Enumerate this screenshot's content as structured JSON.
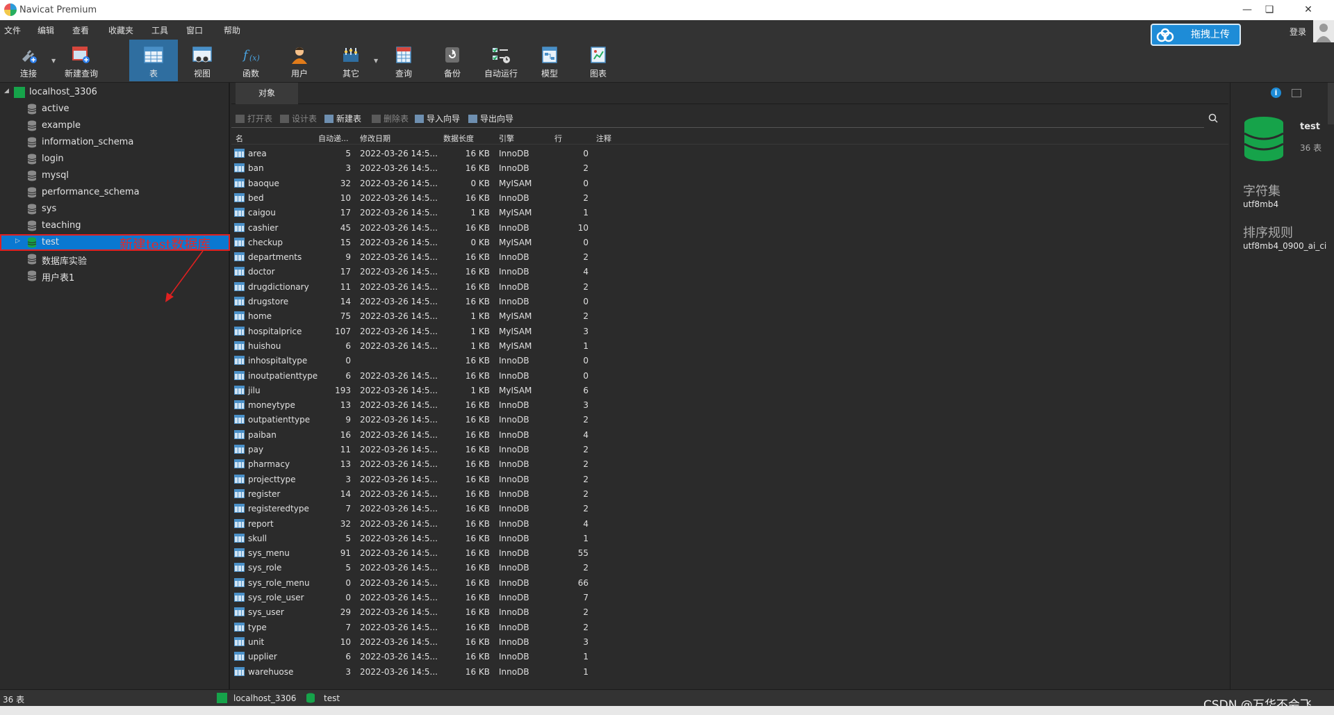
{
  "window": {
    "title": "Navicat Premium"
  },
  "menu": [
    "文件",
    "编辑",
    "查看",
    "收藏夹",
    "工具",
    "窗口",
    "帮助"
  ],
  "toolbar": [
    {
      "label": "连接",
      "icon": "plug-icon"
    },
    {
      "label": "新建查询",
      "icon": "new-query-icon"
    },
    {
      "label": "表",
      "icon": "table-icon",
      "active": true
    },
    {
      "label": "视图",
      "icon": "view-icon"
    },
    {
      "label": "函数",
      "icon": "function-icon"
    },
    {
      "label": "用户",
      "icon": "user-icon"
    },
    {
      "label": "其它",
      "icon": "others-icon"
    },
    {
      "label": "查询",
      "icon": "query-icon"
    },
    {
      "label": "备份",
      "icon": "backup-icon"
    },
    {
      "label": "自动运行",
      "icon": "autorun-icon"
    },
    {
      "label": "模型",
      "icon": "model-icon"
    },
    {
      "label": "图表",
      "icon": "chart-icon"
    }
  ],
  "upload_button": "拖拽上传",
  "login": "登录",
  "tree": {
    "connection": "localhost_3306",
    "databases": [
      "active",
      "example",
      "information_schema",
      "login",
      "mysql",
      "performance_schema",
      "sys",
      "teaching",
      "test",
      "数据库实验",
      "用户表1"
    ],
    "selected": "test"
  },
  "annotation": "新建test数据库",
  "tabs": [
    "对象"
  ],
  "object_toolbar": {
    "open": "打开表",
    "design": "设计表",
    "new": "新建表",
    "delete": "删除表",
    "import": "导入向导",
    "export": "导出向导"
  },
  "table": {
    "columns": [
      "名",
      "自动递...",
      "修改日期",
      "数据长度",
      "引擎",
      "行",
      "注释"
    ],
    "rows": [
      [
        "area",
        "5",
        "2022-03-26 14:5...",
        "16 KB",
        "InnoDB",
        "0"
      ],
      [
        "ban",
        "3",
        "2022-03-26 14:5...",
        "16 KB",
        "InnoDB",
        "2"
      ],
      [
        "baoque",
        "32",
        "2022-03-26 14:5...",
        "0 KB",
        "MyISAM",
        "0"
      ],
      [
        "bed",
        "10",
        "2022-03-26 14:5...",
        "16 KB",
        "InnoDB",
        "2"
      ],
      [
        "caigou",
        "17",
        "2022-03-26 14:5...",
        "1 KB",
        "MyISAM",
        "1"
      ],
      [
        "cashier",
        "45",
        "2022-03-26 14:5...",
        "16 KB",
        "InnoDB",
        "10"
      ],
      [
        "checkup",
        "15",
        "2022-03-26 14:5...",
        "0 KB",
        "MyISAM",
        "0"
      ],
      [
        "departments",
        "9",
        "2022-03-26 14:5...",
        "16 KB",
        "InnoDB",
        "2"
      ],
      [
        "doctor",
        "17",
        "2022-03-26 14:5...",
        "16 KB",
        "InnoDB",
        "4"
      ],
      [
        "drugdictionary",
        "11",
        "2022-03-26 14:5...",
        "16 KB",
        "InnoDB",
        "2"
      ],
      [
        "drugstore",
        "14",
        "2022-03-26 14:5...",
        "16 KB",
        "InnoDB",
        "0"
      ],
      [
        "home",
        "75",
        "2022-03-26 14:5...",
        "1 KB",
        "MyISAM",
        "2"
      ],
      [
        "hospitalprice",
        "107",
        "2022-03-26 14:5...",
        "1 KB",
        "MyISAM",
        "3"
      ],
      [
        "huishou",
        "6",
        "2022-03-26 14:5...",
        "1 KB",
        "MyISAM",
        "1"
      ],
      [
        "inhospitaltype",
        "0",
        "",
        "16 KB",
        "InnoDB",
        "0"
      ],
      [
        "inoutpatienttype",
        "6",
        "2022-03-26 14:5...",
        "16 KB",
        "InnoDB",
        "0"
      ],
      [
        "jilu",
        "193",
        "2022-03-26 14:5...",
        "1 KB",
        "MyISAM",
        "6"
      ],
      [
        "moneytype",
        "13",
        "2022-03-26 14:5...",
        "16 KB",
        "InnoDB",
        "3"
      ],
      [
        "outpatienttype",
        "9",
        "2022-03-26 14:5...",
        "16 KB",
        "InnoDB",
        "2"
      ],
      [
        "paiban",
        "16",
        "2022-03-26 14:5...",
        "16 KB",
        "InnoDB",
        "4"
      ],
      [
        "pay",
        "11",
        "2022-03-26 14:5...",
        "16 KB",
        "InnoDB",
        "2"
      ],
      [
        "pharmacy",
        "13",
        "2022-03-26 14:5...",
        "16 KB",
        "InnoDB",
        "2"
      ],
      [
        "projecttype",
        "3",
        "2022-03-26 14:5...",
        "16 KB",
        "InnoDB",
        "2"
      ],
      [
        "register",
        "14",
        "2022-03-26 14:5...",
        "16 KB",
        "InnoDB",
        "2"
      ],
      [
        "registeredtype",
        "7",
        "2022-03-26 14:5...",
        "16 KB",
        "InnoDB",
        "2"
      ],
      [
        "report",
        "32",
        "2022-03-26 14:5...",
        "16 KB",
        "InnoDB",
        "4"
      ],
      [
        "skull",
        "5",
        "2022-03-26 14:5...",
        "16 KB",
        "InnoDB",
        "1"
      ],
      [
        "sys_menu",
        "91",
        "2022-03-26 14:5...",
        "16 KB",
        "InnoDB",
        "55"
      ],
      [
        "sys_role",
        "5",
        "2022-03-26 14:5...",
        "16 KB",
        "InnoDB",
        "2"
      ],
      [
        "sys_role_menu",
        "0",
        "2022-03-26 14:5...",
        "16 KB",
        "InnoDB",
        "66"
      ],
      [
        "sys_role_user",
        "0",
        "2022-03-26 14:5...",
        "16 KB",
        "InnoDB",
        "7"
      ],
      [
        "sys_user",
        "29",
        "2022-03-26 14:5...",
        "16 KB",
        "InnoDB",
        "2"
      ],
      [
        "type",
        "7",
        "2022-03-26 14:5...",
        "16 KB",
        "InnoDB",
        "2"
      ],
      [
        "unit",
        "10",
        "2022-03-26 14:5...",
        "16 KB",
        "InnoDB",
        "3"
      ],
      [
        "upplier",
        "6",
        "2022-03-26 14:5...",
        "16 KB",
        "InnoDB",
        "1"
      ],
      [
        "warehuose",
        "3",
        "2022-03-26 14:5...",
        "16 KB",
        "InnoDB",
        "1"
      ]
    ]
  },
  "info": {
    "name": "test",
    "count": "36 表",
    "charset_label": "字符集",
    "charset": "utf8mb4",
    "collation_label": "排序规则",
    "collation": "utf8mb4_0900_ai_ci"
  },
  "status": {
    "count": "36 表",
    "connection": "localhost_3306",
    "database": "test"
  },
  "watermark": "CSDN @万华不会飞",
  "colors": {
    "accent": "#0a78d1",
    "annotation": "#e02020",
    "db_green": "#16a34a"
  }
}
